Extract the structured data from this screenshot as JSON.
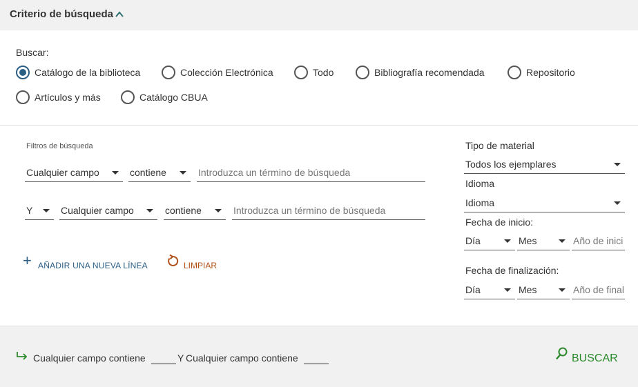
{
  "header": {
    "title": "Criterio de búsqueda"
  },
  "search_scope": {
    "label": "Buscar:",
    "options": [
      {
        "label": "Catálogo de la biblioteca",
        "checked": true
      },
      {
        "label": "Colección Electrónica",
        "checked": false
      },
      {
        "label": "Todo",
        "checked": false
      },
      {
        "label": "Bibliografía recomendada",
        "checked": false
      },
      {
        "label": "Repositorio",
        "checked": false
      },
      {
        "label": "Artículos y más",
        "checked": false
      },
      {
        "label": "Catálogo CBUA",
        "checked": false
      }
    ]
  },
  "filters": {
    "label": "Filtros de búsqueda",
    "row1": {
      "field": "Cualquier campo",
      "operator": "contiene",
      "term_placeholder": "Introduzca un término de búsqueda"
    },
    "row2": {
      "boolean": "Y",
      "field": "Cualquier campo",
      "operator": "contiene",
      "term_placeholder": "Introduzca un término de búsqueda"
    },
    "add_line": "AÑADIR UNA NUEVA LÍNEA",
    "clear": "LIMPIAR"
  },
  "right_panel": {
    "material_type": {
      "label": "Tipo de material",
      "value": "Todos los ejemplares"
    },
    "language": {
      "label": "Idioma",
      "value": "Idioma"
    },
    "start_date": {
      "label": "Fecha de inicio:",
      "day": "Día",
      "month": "Mes",
      "year_placeholder": "Año de inici"
    },
    "end_date": {
      "label": "Fecha de finalización:",
      "day": "Día",
      "month": "Mes",
      "year_placeholder": "Año de final"
    }
  },
  "footer": {
    "summary_part1": "Cualquier campo  contiene",
    "summary_bool": "Y",
    "summary_part2": "Cualquier campo  contiene",
    "search_button": "BUSCAR"
  },
  "colors": {
    "accent_blue": "#2b5e85",
    "clear_orange": "#b0521a",
    "search_green": "#2b8a2b",
    "header_bg": "#f1f1f1"
  }
}
